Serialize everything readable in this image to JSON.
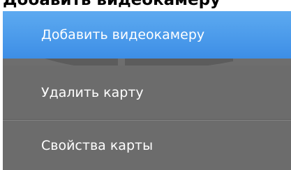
{
  "header": {
    "cut_title": "Добавить видеокамеру"
  },
  "menu": {
    "items": [
      {
        "label": "Добавить видеокамеру",
        "state": "highlighted"
      },
      {
        "label": "Удалить карту"
      },
      {
        "label": "Свойства карты"
      }
    ]
  },
  "colors": {
    "highlight": "#4a9bea",
    "menu_background": "#6c6c6c",
    "text": "#ffffff"
  }
}
